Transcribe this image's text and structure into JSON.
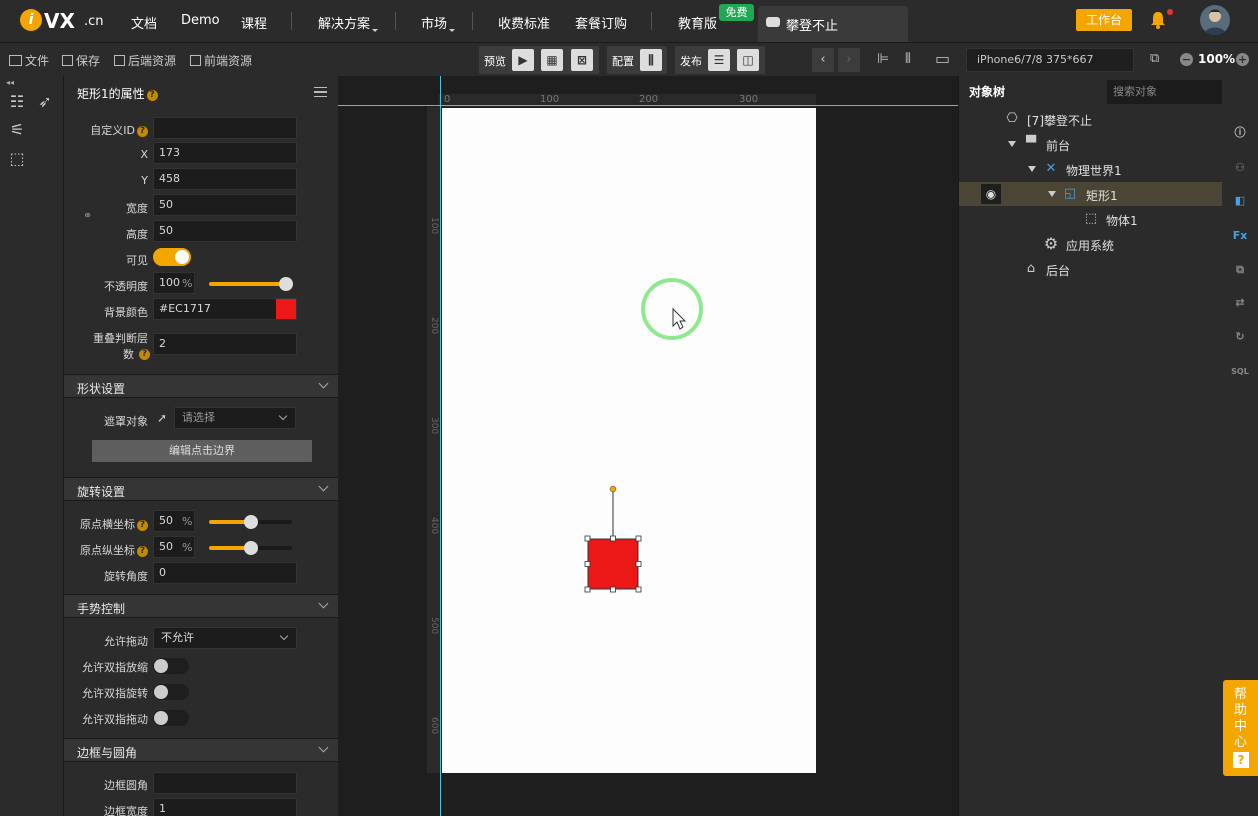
{
  "brand": {
    "logo_mark": "i",
    "logo_text": "VX",
    "logo_suffix": ".cn"
  },
  "nav": {
    "items": [
      "文档",
      "Demo",
      "课程",
      "解决方案",
      "市场",
      "收费标准",
      "套餐订购",
      "教育版"
    ],
    "free_badge": "免费",
    "project_tab": "攀登不止",
    "workbench": "工作台"
  },
  "toolbar": {
    "file": "文件",
    "save": "保存",
    "backend": "后端资源",
    "frontend": "前端资源",
    "preview": "预览",
    "config": "配置",
    "publish": "发布",
    "device": "iPhone6/7/8 375*667",
    "zoom": "100%"
  },
  "props": {
    "title": "矩形1的属性",
    "custom_id_label": "自定义ID",
    "custom_id_value": "",
    "x_label": "X",
    "x_value": "173",
    "y_label": "Y",
    "y_value": "458",
    "width_label": "宽度",
    "width_value": "50",
    "height_label": "高度",
    "height_value": "50",
    "visible_label": "可见",
    "visible": true,
    "opacity_label": "不透明度",
    "opacity_value": "100",
    "opacity_unit": "%",
    "opacity_level": 1.0,
    "bg_color_label": "背景颜色",
    "bg_color_value": "#EC1717",
    "overlap_label_1": "重叠判断层",
    "overlap_label_2": "数",
    "overlap_value": "2",
    "shape_section": "形状设置",
    "mask_label": "遮罩对象",
    "mask_placeholder": "请选择",
    "edit_bounds_button": "编辑点击边界",
    "rotation_section": "旋转设置",
    "origin_x_label": "原点横坐标",
    "origin_x_value": "50",
    "origin_x_level": 0.5,
    "origin_y_label": "原点纵坐标",
    "origin_y_value": "50",
    "origin_y_level": 0.5,
    "percent": "%",
    "rotation_label": "旋转角度",
    "rotation_value": "0",
    "gesture_section": "手势控制",
    "drag_label": "允许拖动",
    "drag_value": "不允许",
    "pinch_label": "允许双指放缩",
    "twist_label": "允许双指旋转",
    "twofinger_drag_label": "允许双指拖动",
    "border_section": "边框与圆角",
    "border_radius_label": "边框圆角",
    "border_radius_value": "",
    "border_width_label": "边框宽度",
    "border_width_value": "1"
  },
  "ruler": {
    "h_ticks": [
      "0",
      "100",
      "200",
      "300"
    ],
    "v_ticks": [
      "100",
      "200",
      "300",
      "400",
      "500",
      "600"
    ]
  },
  "object_tree": {
    "tab": "对象树",
    "search_placeholder": "搜索对象",
    "rows": [
      {
        "label": "[7]攀登不止",
        "icon": "gamepad-icon"
      },
      {
        "label": "前台",
        "icon": "stage-icon"
      },
      {
        "label": "物理世界1",
        "icon": "physics-icon"
      },
      {
        "label": "矩形1",
        "icon": "rectangle-icon"
      },
      {
        "label": "物体1",
        "icon": "body-cube-icon"
      },
      {
        "label": "应用系统",
        "icon": "gear-icon"
      },
      {
        "label": "后台",
        "icon": "home-icon"
      }
    ]
  },
  "help_center": {
    "label": "帮助中心",
    "q": "?"
  },
  "colors": {
    "accent": "#f5a500",
    "rect_fill": "#EC1717",
    "cursor_ring": "#8ee88e",
    "free_badge": "#1fa855"
  }
}
